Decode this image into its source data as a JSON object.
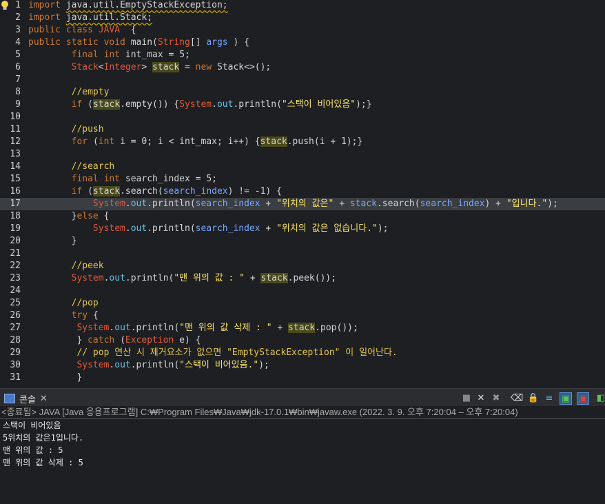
{
  "editor": {
    "lines": [
      {
        "num": "1",
        "segs": [
          [
            "kw",
            "import "
          ],
          [
            "plain",
            "java.util.EmptyStackException;"
          ]
        ]
      },
      {
        "num": "2",
        "segs": [
          [
            "kw",
            "import "
          ],
          [
            "plain",
            "java.util.Stack;"
          ]
        ]
      },
      {
        "num": "3",
        "segs": [
          [
            "kw",
            "public class "
          ],
          [
            "java",
            "JAVA"
          ],
          [
            "plain",
            "  {"
          ]
        ]
      },
      {
        "num": "4",
        "segs": [
          [
            "kw",
            "public static void "
          ],
          [
            "plain",
            "main("
          ],
          [
            "cls",
            "String"
          ],
          [
            "plain",
            "[] "
          ],
          [
            "prm",
            "args"
          ],
          [
            "plain",
            " ) {"
          ]
        ]
      },
      {
        "num": "5",
        "segs": [
          [
            "plain",
            "        "
          ],
          [
            "kw",
            "final int "
          ],
          [
            "plain",
            "int_max = "
          ],
          [
            "num",
            "5"
          ],
          [
            "plain",
            ";"
          ]
        ]
      },
      {
        "num": "6",
        "segs": [
          [
            "plain",
            "        "
          ],
          [
            "cls",
            "Stack"
          ],
          [
            "plain",
            "<"
          ],
          [
            "cls",
            "Integer"
          ],
          [
            "plain",
            "> "
          ],
          [
            "var",
            "stack"
          ],
          [
            "plain",
            " = "
          ],
          [
            "kw",
            "new "
          ],
          [
            "plain",
            "Stack<>();"
          ]
        ]
      },
      {
        "num": "7",
        "segs": []
      },
      {
        "num": "8",
        "segs": [
          [
            "plain",
            "        "
          ],
          [
            "cmt",
            "//empty"
          ]
        ]
      },
      {
        "num": "9",
        "segs": [
          [
            "plain",
            "        "
          ],
          [
            "kw",
            "if "
          ],
          [
            "plain",
            "("
          ],
          [
            "var",
            "stack"
          ],
          [
            "plain",
            ".empty()) {"
          ],
          [
            "sys",
            "System"
          ],
          [
            "plain",
            "."
          ],
          [
            "out",
            "out"
          ],
          [
            "plain",
            ".println("
          ],
          [
            "str",
            "\"스택이 비어있음\""
          ],
          [
            "plain",
            ");}"
          ]
        ]
      },
      {
        "num": "10",
        "segs": []
      },
      {
        "num": "11",
        "segs": [
          [
            "plain",
            "        "
          ],
          [
            "cmt",
            "//push"
          ]
        ]
      },
      {
        "num": "12",
        "segs": [
          [
            "plain",
            "        "
          ],
          [
            "kw",
            "for "
          ],
          [
            "plain",
            "("
          ],
          [
            "kw",
            "int "
          ],
          [
            "plain",
            "i = "
          ],
          [
            "num",
            "0"
          ],
          [
            "plain",
            "; i < int_max; i++) {"
          ],
          [
            "var",
            "stack"
          ],
          [
            "plain",
            ".push(i + "
          ],
          [
            "num",
            "1"
          ],
          [
            "plain",
            ");}"
          ]
        ]
      },
      {
        "num": "13",
        "segs": []
      },
      {
        "num": "14",
        "segs": [
          [
            "plain",
            "        "
          ],
          [
            "cmt",
            "//search"
          ]
        ]
      },
      {
        "num": "15",
        "segs": [
          [
            "plain",
            "        "
          ],
          [
            "kw",
            "final int "
          ],
          [
            "plain",
            "search_index = "
          ],
          [
            "num",
            "5"
          ],
          [
            "plain",
            ";"
          ]
        ]
      },
      {
        "num": "16",
        "segs": [
          [
            "plain",
            "        "
          ],
          [
            "kw",
            "if "
          ],
          [
            "plain",
            "("
          ],
          [
            "var",
            "stack"
          ],
          [
            "plain",
            ".search("
          ],
          [
            "prm",
            "search_index"
          ],
          [
            "plain",
            ") != -"
          ],
          [
            "num",
            "1"
          ],
          [
            "plain",
            ") {"
          ]
        ]
      },
      {
        "num": "17",
        "segs": [
          [
            "plain",
            "            "
          ],
          [
            "sys",
            "System"
          ],
          [
            "plain",
            "."
          ],
          [
            "out",
            "out"
          ],
          [
            "plain",
            ".println("
          ],
          [
            "prm",
            "search_index"
          ],
          [
            "plain",
            " + "
          ],
          [
            "str",
            "\"위치의 값은\""
          ],
          [
            "plain",
            " + "
          ],
          [
            "prm",
            "stack"
          ],
          [
            "plain",
            ".search("
          ],
          [
            "prm",
            "search_index"
          ],
          [
            "plain",
            ") + "
          ],
          [
            "str",
            "\"입니다.\""
          ],
          [
            "plain",
            ");"
          ]
        ]
      },
      {
        "num": "18",
        "segs": [
          [
            "plain",
            "        }"
          ],
          [
            "kw",
            "else "
          ],
          [
            "plain",
            "{"
          ]
        ]
      },
      {
        "num": "19",
        "segs": [
          [
            "plain",
            "            "
          ],
          [
            "sys",
            "System"
          ],
          [
            "plain",
            "."
          ],
          [
            "out",
            "out"
          ],
          [
            "plain",
            ".println("
          ],
          [
            "prm",
            "search_index"
          ],
          [
            "plain",
            " + "
          ],
          [
            "str",
            "\"위치의 값은 없습니다.\""
          ],
          [
            "plain",
            ");"
          ]
        ]
      },
      {
        "num": "20",
        "segs": [
          [
            "plain",
            "        }"
          ]
        ]
      },
      {
        "num": "21",
        "segs": []
      },
      {
        "num": "22",
        "segs": [
          [
            "plain",
            "        "
          ],
          [
            "cmt",
            "//peek"
          ]
        ]
      },
      {
        "num": "23",
        "segs": [
          [
            "plain",
            "        "
          ],
          [
            "sys",
            "System"
          ],
          [
            "plain",
            "."
          ],
          [
            "out",
            "out"
          ],
          [
            "plain",
            ".println("
          ],
          [
            "str",
            "\"맨 위의 값 : \""
          ],
          [
            "plain",
            " + "
          ],
          [
            "var",
            "stack"
          ],
          [
            "plain",
            ".peek());"
          ]
        ]
      },
      {
        "num": "24",
        "segs": []
      },
      {
        "num": "25",
        "segs": [
          [
            "plain",
            "        "
          ],
          [
            "cmt",
            "//pop"
          ]
        ]
      },
      {
        "num": "26",
        "segs": [
          [
            "plain",
            "        "
          ],
          [
            "kw",
            "try "
          ],
          [
            "plain",
            "{"
          ]
        ]
      },
      {
        "num": "27",
        "segs": [
          [
            "plain",
            "         "
          ],
          [
            "sys",
            "System"
          ],
          [
            "plain",
            "."
          ],
          [
            "out",
            "out"
          ],
          [
            "plain",
            ".println("
          ],
          [
            "str",
            "\"맨 위의 값 삭제 : \""
          ],
          [
            "plain",
            " + "
          ],
          [
            "var",
            "stack"
          ],
          [
            "plain",
            ".pop());"
          ]
        ]
      },
      {
        "num": "28",
        "segs": [
          [
            "plain",
            "         } "
          ],
          [
            "kw",
            "catch "
          ],
          [
            "plain",
            "("
          ],
          [
            "cls",
            "Exception"
          ],
          [
            "plain",
            " e) {"
          ]
        ]
      },
      {
        "num": "29",
        "segs": [
          [
            "plain",
            "         "
          ],
          [
            "cmt",
            "// pop 연산 시 제거요소가 없으면 \"EmptyStackException\" 이 일어난다."
          ]
        ]
      },
      {
        "num": "30",
        "segs": [
          [
            "plain",
            "         "
          ],
          [
            "sys",
            "System"
          ],
          [
            "plain",
            "."
          ],
          [
            "out",
            "out"
          ],
          [
            "plain",
            ".println("
          ],
          [
            "str",
            "\"스택이 비어있음.\""
          ],
          [
            "plain",
            ");"
          ]
        ]
      },
      {
        "num": "31",
        "segs": [
          [
            "plain",
            "         }"
          ]
        ]
      }
    ],
    "current_line": "17"
  },
  "console": {
    "tab_label": "콘솔",
    "tab_close": "✕",
    "status": "<종료됨> JAVA [Java 응용프로그램] C:₩Program Files₩Java₩jdk-17.0.1₩bin₩javaw.exe (2022. 3. 9. 오후 7:20:04 – 오후 7:20:04)",
    "output": [
      "스택이 비어있음",
      "5위치의 값은1입니다.",
      "맨 위의 값 : 5",
      "맨 위의 값 삭제 : 5"
    ],
    "tools": [
      {
        "name": "terminate-icon",
        "glyph": "■"
      },
      {
        "name": "remove-launch-icon",
        "glyph": "✕"
      },
      {
        "name": "remove-all-terminated-icon",
        "glyph": "✖"
      },
      {
        "name": "clear-console-icon",
        "glyph": "⌫"
      },
      {
        "name": "scroll-lock-icon",
        "glyph": "🔒"
      },
      {
        "name": "word-wrap-icon",
        "glyph": "≡"
      },
      {
        "name": "show-console-output-icon",
        "glyph": "▣"
      },
      {
        "name": "show-console-error-icon",
        "glyph": "▣"
      },
      {
        "name": "pin-console-icon",
        "glyph": "◧"
      }
    ]
  }
}
